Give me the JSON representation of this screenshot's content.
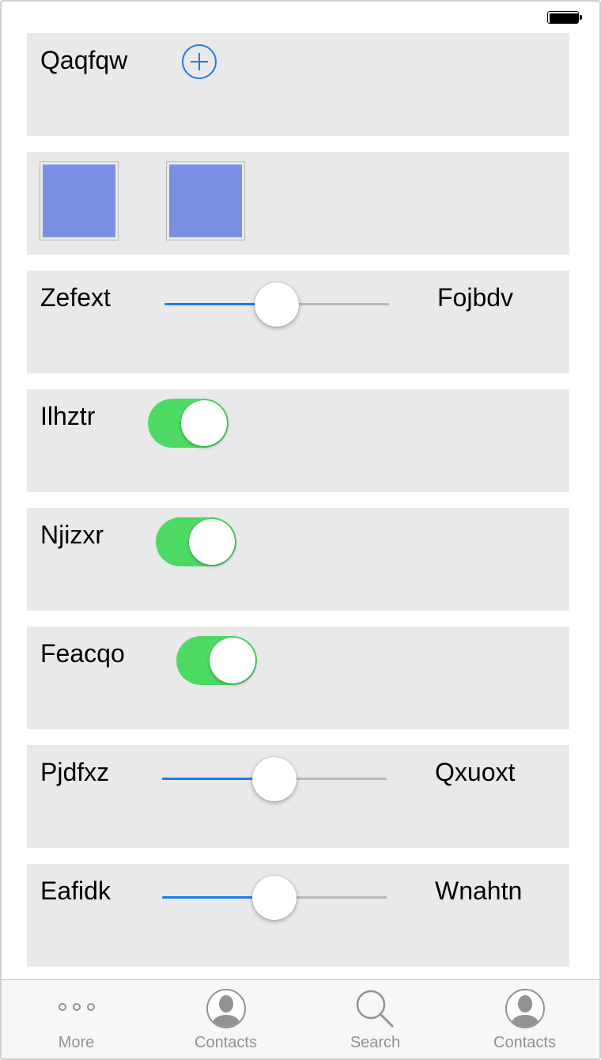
{
  "status_bar": {
    "battery_icon": "battery-full-icon"
  },
  "rows": {
    "add_row": {
      "label": "Qaqfqw",
      "button_icon": "plus-circle-icon",
      "accent": "#1a7cf0"
    },
    "swatch_row": {
      "swatch_color": "#7a8fe3",
      "count": 2
    },
    "slider_1": {
      "left_label": "Zefext",
      "right_label": "Fojbdv",
      "value": 0.5
    },
    "toggle_1": {
      "label": "Ilhztr",
      "on": true
    },
    "toggle_2": {
      "label": "Njizxr",
      "on": true
    },
    "toggle_3": {
      "label": "Feacqo",
      "on": true
    },
    "slider_2": {
      "left_label": "Pjdfxz",
      "right_label": "Qxuoxt",
      "value": 0.5
    },
    "slider_3": {
      "left_label": "Eafidk",
      "right_label": "Wnahtn",
      "value": 0.5
    }
  },
  "colors": {
    "toggle_on": "#4cd964",
    "slider_fill": "#1a7cf0",
    "row_bg": "#e9e9e9"
  },
  "tab_bar": {
    "tabs": [
      {
        "label": "More",
        "icon": "more-dots-icon"
      },
      {
        "label": "Contacts",
        "icon": "contact-person-icon"
      },
      {
        "label": "Search",
        "icon": "search-icon"
      },
      {
        "label": "Contacts",
        "icon": "contact-person-icon"
      }
    ]
  }
}
